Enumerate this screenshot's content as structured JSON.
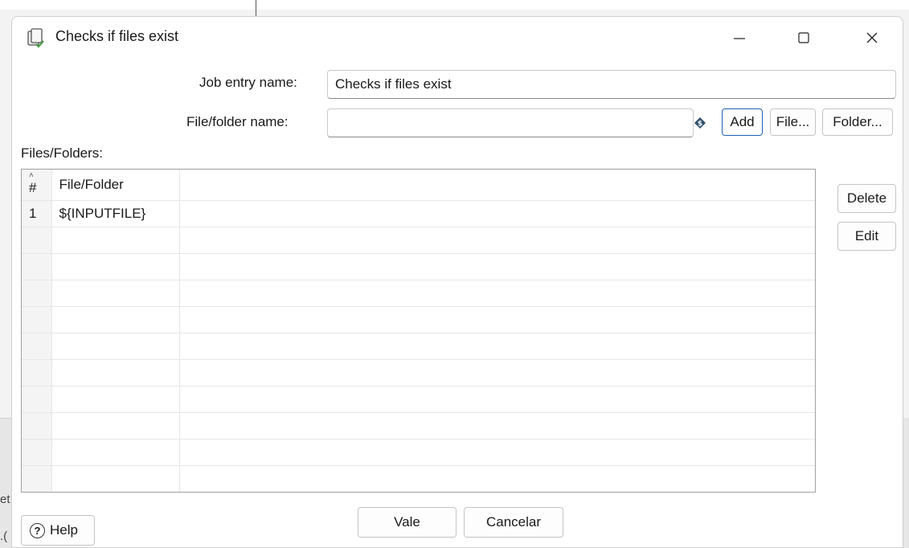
{
  "dialog": {
    "title": "Checks if files exist",
    "icon": "check-files-icon",
    "window_controls": [
      "minimize-icon",
      "maximize-icon",
      "close-icon"
    ]
  },
  "form": {
    "job_entry_label": "Job entry name:",
    "job_entry_value": "Checks if files exist",
    "file_folder_label": "File/folder name:",
    "file_folder_value": "",
    "variable_icon": "variable-icon",
    "add_label": "Add",
    "file_label": "File...",
    "folder_label": "Folder..."
  },
  "files_section": {
    "label": "Files/Folders:",
    "columns": [
      "#",
      "File/Folder"
    ],
    "rows": [
      {
        "num": "1",
        "path": "${INPUTFILE}"
      }
    ],
    "delete_label": "Delete",
    "edit_label": "Edit"
  },
  "footer": {
    "help_label": "Help",
    "ok_label": "Vale",
    "cancel_label": "Cancelar"
  },
  "colors": {
    "accent": "#1f63b8",
    "dialog_bg": "#ffffff",
    "index_col_bg": "#f4f4f4"
  }
}
